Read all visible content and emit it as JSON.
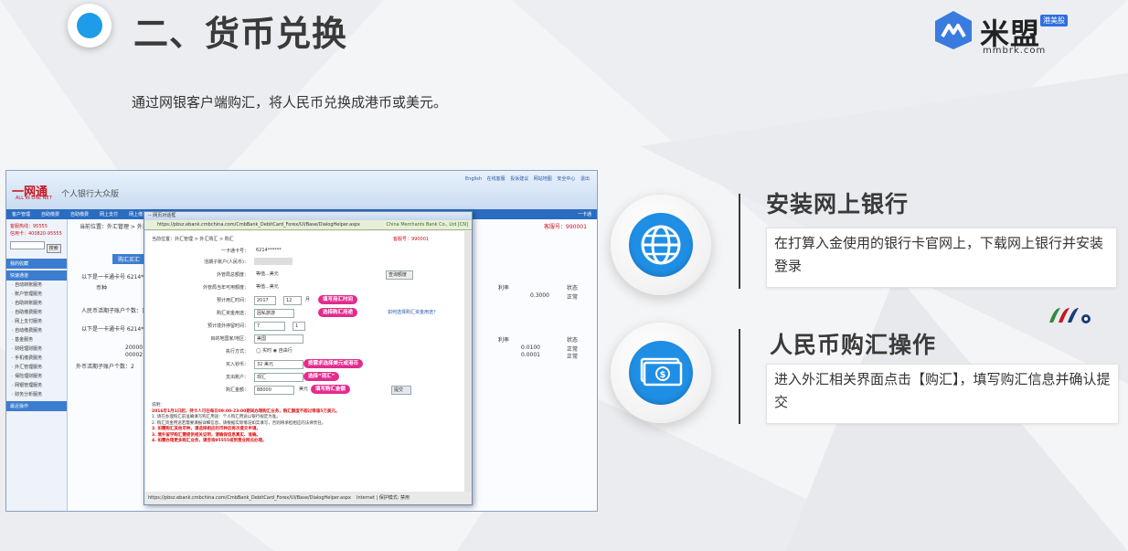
{
  "header": {
    "title": "二、货币兑换",
    "subtitle": "通过网银客户端购汇，将人民币兑换成港币或美元。"
  },
  "logo": {
    "name": "米盟",
    "tag": "港美股",
    "url": "mmbrk.com"
  },
  "screenshot": {
    "bank_logo": "一网通",
    "bank_logo_sub": "ALL IN ONE NET",
    "bank_name": "个人银行大众版",
    "top_links": "English  在线客服  投诉建议  网站地图  安全中心  退出",
    "nav_items": [
      "客户管理",
      "自助缴费",
      "自助缴费",
      "网上支付",
      "网上缴费",
      "一卡通"
    ],
    "left_info": [
      "客服热线：95555",
      "信用卡：400820-95555"
    ],
    "search_btn": "搜索",
    "left_menu_headers": [
      "我的收藏",
      "快速通道",
      "最近操作"
    ],
    "left_menu_items": [
      "· 自动转账服务",
      "· 账户管理服务",
      "· 自助转账服务",
      "· 自助缴费服务",
      "· 网上支付服务",
      "· 自动缴费服务",
      "· 基金服务",
      "· 财经理财服务",
      "· 手机缴费服务",
      "· 外汇管理服务",
      "· 保险理财服务",
      "· 网银管理服务",
      "· 财务分析服务"
    ],
    "main_breadcrumb": "当前位置：外汇管理 > 外汇买卖",
    "main_tab": "购汇买汇",
    "main_rows": [
      "以下是一卡通卡号 6214****",
      "人民币活期子账户个数：1",
      "以下是一卡通卡号 6214****",
      "外币活期子账户个数：2"
    ],
    "main_cols": [
      "币种",
      "利率",
      "状态"
    ],
    "main_values": [
      "0.3000",
      "正常",
      "0.0100",
      "正常",
      "0.0001",
      "正常"
    ],
    "main_codes": [
      "20000",
      "00002"
    ],
    "main_right_text": "客服号：990001",
    "dialog": {
      "title": "-- 网页对话框",
      "address": "https://pbsz.ebank.cmbchina.com/CmbBank_DebitCard_Forex/UI/Base/DialogHelper.aspx",
      "address_right": "China Merchants Bank Co., Ltd [CN]",
      "breadcrumb": "当前位置：外汇管理 > 外汇购汇 > 购汇",
      "right_tag": "客服号：990001",
      "fields": [
        {
          "label": "一卡通卡号：",
          "value": "6214******"
        },
        {
          "label": "活期子账户(人民币)：",
          "value": ""
        },
        {
          "label": "外管局总额度：",
          "value": "等值...美元"
        },
        {
          "label": "外管局当年可用额度：",
          "value": "等值...美元"
        },
        {
          "label": "预计用汇时间：",
          "value": "2017"
        },
        {
          "label": "购汇资金用途：",
          "value": "因私旅游"
        },
        {
          "label": "预计境外停留时间：",
          "value": "7"
        },
        {
          "label": "目的地国家/地区：",
          "value": "美国"
        },
        {
          "label": "执行方式：",
          "value": "◯ 实时  ◉ 自由行"
        },
        {
          "label": "买入钞币：",
          "value": "32 美元"
        },
        {
          "label": "支出账户：",
          "value": "现汇"
        },
        {
          "label": "购汇金额：",
          "value": "88000"
        }
      ],
      "extra_values": {
        "month": "12",
        "day_label": "月",
        "day_value": "1",
        "unit": "美元",
        "query": "查询额度",
        "submit": "提交",
        "purpose_link": "如何选择购汇资金用途？"
      },
      "notice_title": "说明：",
      "notice_lines": [
        "2016年1月1日起，持卡人可在每日09:00-23:00期间办理购汇业务，购汇额度不超过等值5万美元。",
        "1. 请在办理购汇前准确填写购汇用途：个人购汇用途以银行规定为准。",
        "2. 购汇资金用途若需要填报详细信息，请根据实际情况如实填写，否则将承担相应的法律责任。",
        "3. 如需购汇其他币种，请选择相应的币种后再次提交申请。",
        "3. 境外留学购汇需提供相关证明，请确保信息真实、准确。",
        "4. 如需办理更多购汇业务，请咨询95555或到营业网点办理。"
      ],
      "status": "https://pbsz.ebank.cmbchina.com/CmbBank_DebitCard_Forex/UI/Base/DialogHelper.aspx",
      "status_right": "Internet | 保护模式: 禁用"
    },
    "callouts": [
      "填写用汇时间",
      "选择购汇用途",
      "按需求选择美元或港币",
      "选择“现汇”",
      "填写购汇金额"
    ]
  },
  "cards": [
    {
      "title": "安装网上银行",
      "desc": "在打算入金使用的银行卡官网上，下载网上银行并安装登录",
      "icon": "globe-icon"
    },
    {
      "title": "人民币购汇操作",
      "desc": "进入外汇相关界面点击【购汇】，填写购汇信息并确认提交",
      "icon": "money-icon"
    }
  ],
  "colors": {
    "accent": "#1f8fe6",
    "pill": "#e32b8e",
    "title": "#3a3a3a"
  }
}
